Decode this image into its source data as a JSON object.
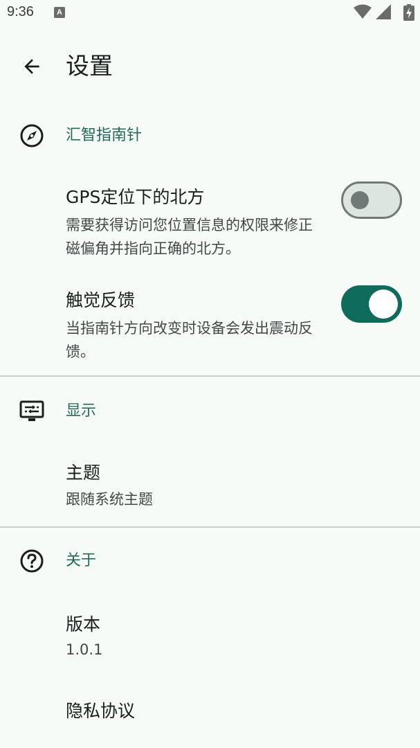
{
  "status_bar": {
    "time": "9:36",
    "notification_icon_letter": "A",
    "icons": [
      "wifi-icon",
      "cell-signal-icon",
      "battery-charging-icon"
    ]
  },
  "app_bar": {
    "back_icon": "arrow-left-icon",
    "title": "设置"
  },
  "sections": {
    "compass": {
      "icon": "compass-icon",
      "title": "汇智指南针",
      "gps_north": {
        "title": "GPS定位下的北方",
        "summary": "需要获得访问您位置信息的权限来修正磁偏角并指向正确的北方。",
        "enabled": false
      },
      "haptic": {
        "title": "触觉反馈",
        "summary": "当指南针方向改变时设备会发出震动反馈。",
        "enabled": true
      }
    },
    "display": {
      "icon": "display-settings-icon",
      "title": "显示",
      "theme": {
        "title": "主题",
        "summary": "跟随系统主题"
      }
    },
    "about": {
      "icon": "help-circle-icon",
      "title": "关于",
      "version": {
        "title": "版本",
        "summary": "1.0.1"
      },
      "privacy": {
        "title": "隐私协议"
      }
    }
  },
  "colors": {
    "background": "#f6fbf8",
    "accent": "#206a5a",
    "switch_on": "#0f6b5a",
    "switch_off_outline": "#6f7975",
    "divider": "#c8cdcb"
  }
}
